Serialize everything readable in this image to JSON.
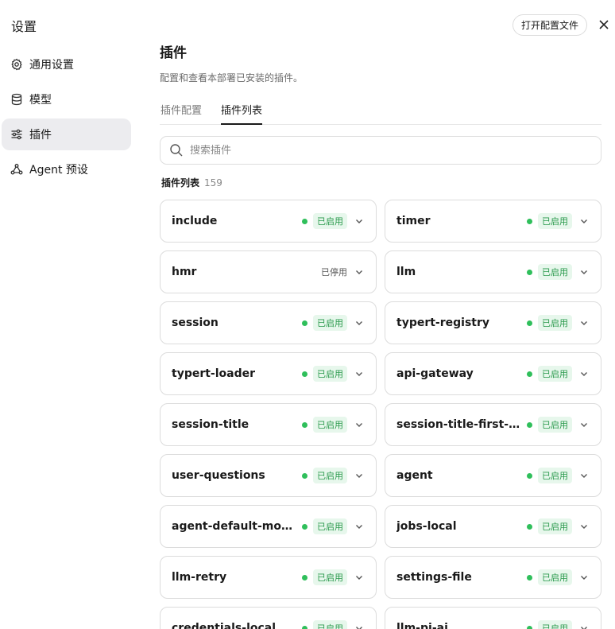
{
  "sidebar": {
    "title": "设置",
    "items": [
      {
        "label": "通用设置",
        "icon": "gear-icon"
      },
      {
        "label": "模型",
        "icon": "database-icon"
      },
      {
        "label": "插件",
        "icon": "sliders-icon",
        "active": true
      },
      {
        "label": "Agent 预设",
        "icon": "agent-icon"
      }
    ]
  },
  "header": {
    "open_config_label": "打开配置文件",
    "close_icon": "close-icon"
  },
  "main": {
    "title": "插件",
    "description": "配置和查看本部署已安装的插件。",
    "tabs": [
      {
        "label": "插件配置",
        "active": false
      },
      {
        "label": "插件列表",
        "active": true
      }
    ],
    "search": {
      "placeholder": "搜索插件",
      "value": ""
    },
    "list_label": "插件列表",
    "list_count": "159",
    "plugins": [
      {
        "name": "include",
        "status": "已启用",
        "enabled": true
      },
      {
        "name": "timer",
        "status": "已启用",
        "enabled": true
      },
      {
        "name": "hmr",
        "status": "已停用",
        "enabled": false
      },
      {
        "name": "llm",
        "status": "已启用",
        "enabled": true
      },
      {
        "name": "session",
        "status": "已启用",
        "enabled": true
      },
      {
        "name": "typert-registry",
        "status": "已启用",
        "enabled": true
      },
      {
        "name": "typert-loader",
        "status": "已启用",
        "enabled": true
      },
      {
        "name": "api-gateway",
        "status": "已启用",
        "enabled": true
      },
      {
        "name": "session-title",
        "status": "已启用",
        "enabled": true
      },
      {
        "name": "session-title-first-pr...",
        "status": "已启用",
        "enabled": true
      },
      {
        "name": "user-questions",
        "status": "已启用",
        "enabled": true
      },
      {
        "name": "agent",
        "status": "已启用",
        "enabled": true
      },
      {
        "name": "agent-default-model",
        "status": "已启用",
        "enabled": true
      },
      {
        "name": "jobs-local",
        "status": "已启用",
        "enabled": true
      },
      {
        "name": "llm-retry",
        "status": "已启用",
        "enabled": true
      },
      {
        "name": "settings-file",
        "status": "已启用",
        "enabled": true
      },
      {
        "name": "credentials-local",
        "status": "已启用",
        "enabled": true
      },
      {
        "name": "llm-pi-ai",
        "status": "已启用",
        "enabled": true
      }
    ]
  },
  "colors": {
    "enabled_dot": "#2fbf5b",
    "enabled_badge_text": "#2a9a4c",
    "enabled_badge_bg": "#e7f7ec",
    "active_nav_bg": "#ececef"
  }
}
